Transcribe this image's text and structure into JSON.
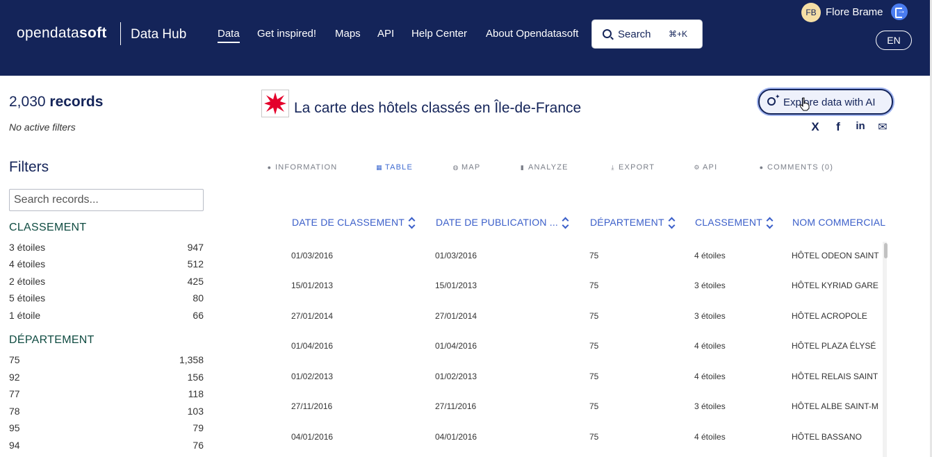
{
  "header": {
    "logo_light": "opendata",
    "logo_bold": "soft",
    "hub_title": "Data Hub",
    "nav": [
      "Data",
      "Get inspired!",
      "Maps",
      "API",
      "Help Center",
      "About Opendatasoft"
    ],
    "search_label": "Search",
    "search_shortcut": "⌘+K",
    "user_initials": "FB",
    "user_name": "Flore Brame",
    "language": "EN"
  },
  "sidebar": {
    "records_count": "2,030",
    "records_label": "records",
    "no_filters": "No active filters",
    "filters_title": "Filters",
    "search_placeholder": "Search records...",
    "facets": [
      {
        "title": "CLASSEMENT",
        "items": [
          {
            "label": "3 étoiles",
            "count": "947"
          },
          {
            "label": "4 étoiles",
            "count": "512"
          },
          {
            "label": "2 étoiles",
            "count": "425"
          },
          {
            "label": "5 étoiles",
            "count": "80"
          },
          {
            "label": "1 étoile",
            "count": "66"
          }
        ]
      },
      {
        "title": "DÉPARTEMENT",
        "items": [
          {
            "label": "75",
            "count": "1,358"
          },
          {
            "label": "92",
            "count": "156"
          },
          {
            "label": "77",
            "count": "118"
          },
          {
            "label": "78",
            "count": "103"
          },
          {
            "label": "95",
            "count": "79"
          },
          {
            "label": "94",
            "count": "76"
          }
        ]
      }
    ]
  },
  "dataset": {
    "title": "La carte des hôtels classés en Île-de-France",
    "ai_button": "Explore data with AI",
    "share": [
      "X",
      "f",
      "in",
      "✉"
    ]
  },
  "tabs": [
    {
      "label": "INFORMATION",
      "icon": "info-icon",
      "glyph": "●"
    },
    {
      "label": "TABLE",
      "icon": "table-icon",
      "glyph": "▦"
    },
    {
      "label": "MAP",
      "icon": "globe-icon",
      "glyph": "◍"
    },
    {
      "label": "ANALYZE",
      "icon": "chart-icon",
      "glyph": "▮"
    },
    {
      "label": "EXPORT",
      "icon": "download-icon",
      "glyph": "⤓"
    },
    {
      "label": "API",
      "icon": "gears-icon",
      "glyph": "⚙"
    },
    {
      "label": "COMMENTS (0)",
      "icon": "comments-icon",
      "glyph": "●"
    }
  ],
  "table": {
    "columns": [
      "DATE DE CLASSEMENT",
      "DATE DE PUBLICATION ...",
      "DÉPARTEMENT",
      "CLASSEMENT",
      "NOM COMMERCIAL"
    ],
    "rows": [
      [
        "01/03/2016",
        "01/03/2016",
        "75",
        "4 étoiles",
        "HÔTEL ODEON SAINT"
      ],
      [
        "15/01/2013",
        "15/01/2013",
        "75",
        "3 étoiles",
        "HÔTEL KYRIAD GARE"
      ],
      [
        "27/01/2014",
        "27/01/2014",
        "75",
        "3 étoiles",
        "HÔTEL ACROPOLE"
      ],
      [
        "01/04/2016",
        "01/04/2016",
        "75",
        "4 étoiles",
        "HÔTEL PLAZA ÉLYSÉ"
      ],
      [
        "01/02/2013",
        "01/02/2013",
        "75",
        "4 étoiles",
        "HÔTEL RELAIS SAINT"
      ],
      [
        "27/11/2016",
        "27/11/2016",
        "75",
        "3 étoiles",
        "HÔTEL ALBE SAINT-M"
      ],
      [
        "04/01/2016",
        "04/01/2016",
        "75",
        "4 étoiles",
        "HÔTEL BASSANO"
      ]
    ]
  },
  "colors": {
    "header_bg": "#142459",
    "accent_blue": "#3a5ec9",
    "facet_green": "#0f4b41",
    "logo_red": "#e4002b"
  }
}
